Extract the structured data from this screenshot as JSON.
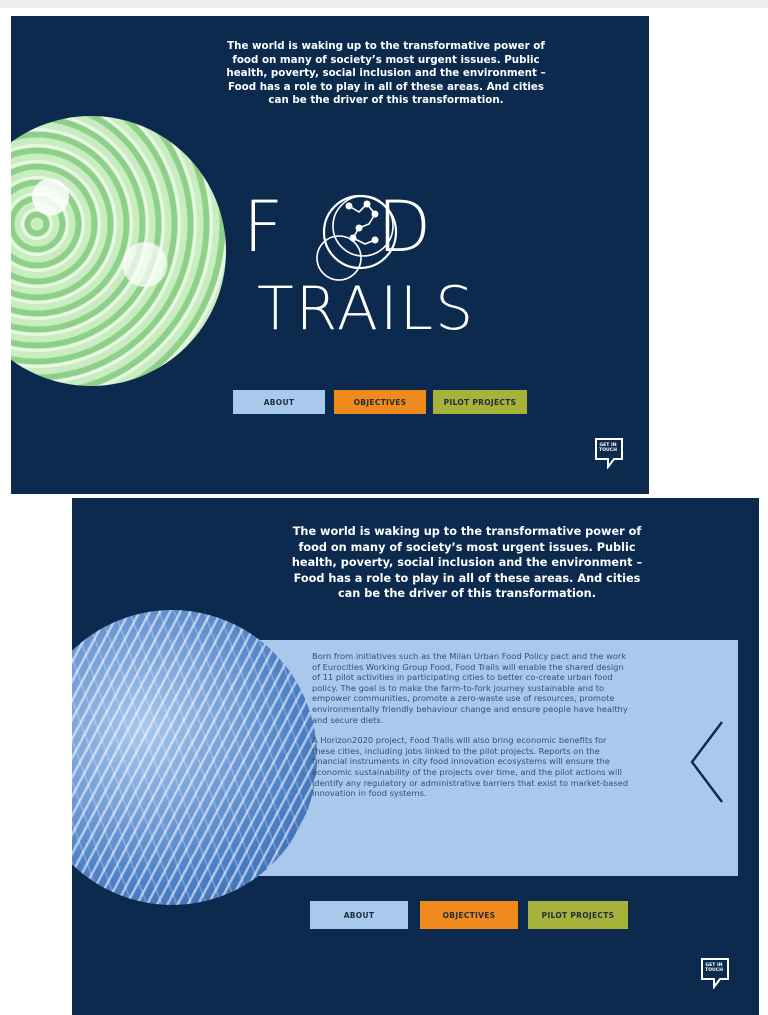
{
  "intro_text": "The world is waking up to the transformative power of\nfood on many of society’s most urgent issues. Public\nhealth, poverty, social inclusion and the environment –\nFood has a role to play in all of these areas. And cities\ncan be the driver of this transformation.",
  "logo": {
    "line1_left": "F",
    "line1_right": "D",
    "line2": "TRAILS"
  },
  "nav": {
    "about": "ABOUT",
    "objectives": "OBJECTIVES",
    "pilot": "PILOT PROJECTS"
  },
  "get_in_touch": "GET IN TOUCH",
  "info": {
    "paragraph1": "Born from initiatives such as the Milan Urban Food Policy pact and the work of Eurocities Working Group Food, Food Trails will enable the shared design of 11 pilot activities in participating cities to better co-create urban food policy. The goal is to make the farm-to-fork journey sustainable and to empower communities, promote a zero-waste use of resources, promote environmentally friendly behaviour change and ensure people have healthy and secure diets.",
    "paragraph2": "A Horizon2020 project, Food Trails will also bring economic benefits for these cities, including jobs linked to the pilot projects. Reports on the financial instruments in city food innovation ecosystems will ensure the economic sustainability of the projects over time, and the pilot actions will identify any regulatory or administrative barriers that exist to market-based innovation in food systems."
  },
  "colors": {
    "navy": "#0b2a4e",
    "light_blue": "#a8c9ec",
    "orange": "#f08a1c",
    "olive": "#a6b23a"
  }
}
